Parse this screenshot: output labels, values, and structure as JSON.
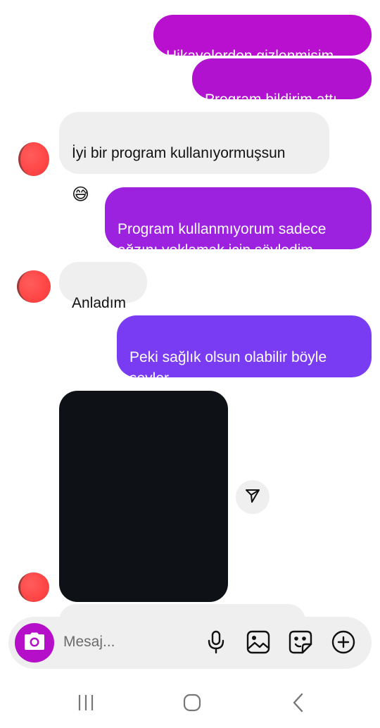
{
  "messages": [
    {
      "text": "Hikayelerden gizlenmişim",
      "direction": "outgoing",
      "color": "#b90fce"
    },
    {
      "text": "Program bildirim attı",
      "direction": "outgoing",
      "color": "#b112d0"
    },
    {
      "text": "İyi bir program kullanıyormuşsun",
      "emoji": "😅",
      "direction": "incoming"
    },
    {
      "text": "Program kullanmıyorum sadece\nağzını yoklamak için söyledim",
      "direction": "outgoing",
      "color": "#9d22e0"
    },
    {
      "text": "Anladım",
      "direction": "incoming"
    },
    {
      "text": "Peki sağlık olsun olabilir böyle\nşeyler",
      "direction": "outgoing",
      "color": "#7a3cf2"
    }
  ],
  "media": {
    "share_icon": "paper-plane-icon"
  },
  "composer": {
    "placeholder": "Mesaj...",
    "camera_icon": "camera-icon",
    "icons": [
      "microphone-icon",
      "image-icon",
      "sticker-icon",
      "plus-circle-icon"
    ],
    "accent": "#b50fc9"
  },
  "navbar": {
    "icons": [
      "recent-apps-icon",
      "home-icon",
      "back-icon"
    ]
  }
}
